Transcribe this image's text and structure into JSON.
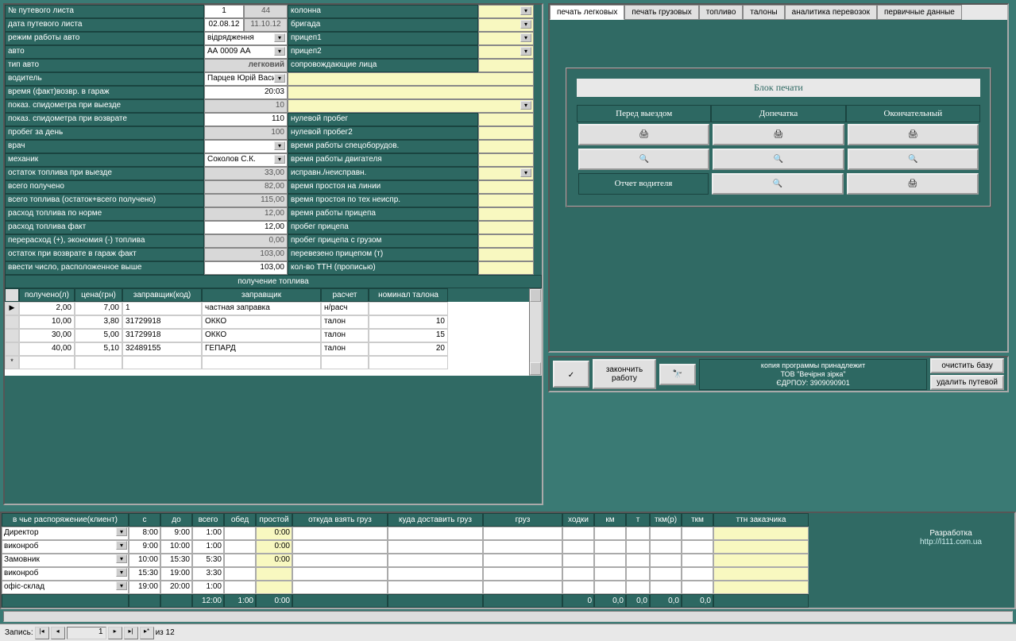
{
  "form_left": {
    "labels": [
      "№ путевого листа",
      "дата путевого листа",
      "режим работы авто",
      "авто",
      "тип авто",
      "водитель",
      "время (факт)возвр. в гараж",
      "показ. спидометра при выезде",
      "показ. спидометра при возврате",
      "пробег за день",
      "врач",
      "механик",
      "остаток топлива при выезде",
      "всего получено",
      "всего топлива (остаток+всего получено)",
      "расход топлива по норме",
      "расход топлива факт",
      "перерасход (+), экономия (-) топлива",
      "остаток при возврате в гараж  факт",
      "ввести число, расположенное выше"
    ],
    "v1a": "1",
    "v1b": "44",
    "v2a": "02.08.12",
    "v2b": "11.10.12",
    "v3": "відрядження",
    "v4": "АА 0009 АА",
    "v5": "легковий",
    "v6": "Парцев Юрій Васи",
    "v7": "20:03",
    "v8": "10",
    "v9": "110",
    "v10": "100",
    "v12": "Соколов С.К.",
    "v13": "33,00",
    "v14": "82,00",
    "v15": "115,00",
    "v16": "12,00",
    "v17": "12,00",
    "v18": "0,00",
    "v19": "103,00",
    "v20": "103,00"
  },
  "form_right": {
    "labels": [
      "колонна",
      "бригада",
      "прицеп1",
      "прицеп2",
      "сопровождающие лица",
      "",
      "",
      "",
      "нулевой пробег",
      "нулевой пробег2",
      "время работы спецоборудов.",
      "время работы двигателя",
      "исправн./неисправн.",
      "время простоя на линии",
      "время простоя по тех неиспр.",
      "время работы прицепа",
      "пробег прицепа",
      "пробег прицепа с грузом",
      "перевезено прицепом (т)",
      "кол-во ТТН (прописью)"
    ]
  },
  "fuel": {
    "title": "получение топлива",
    "headers": [
      "получено(л)",
      "цена(грн)",
      "заправщик(код)",
      "заправщик",
      "расчет",
      "номинал талона"
    ],
    "rows": [
      {
        "l": "2,00",
        "p": "7,00",
        "code": "1",
        "who": "частная заправка",
        "calc": "н/расч",
        "nom": ""
      },
      {
        "l": "10,00",
        "p": "3,80",
        "code": "31729918",
        "who": "ОККО",
        "calc": "талон",
        "nom": "10"
      },
      {
        "l": "30,00",
        "p": "5,00",
        "code": "31729918",
        "who": "ОККО",
        "calc": "талон",
        "nom": "15"
      },
      {
        "l": "40,00",
        "p": "5,10",
        "code": "32489155",
        "who": "ГЕПАРД",
        "calc": "талон",
        "nom": "20"
      }
    ]
  },
  "tabs": [
    "печать легковых",
    "печать грузовых",
    "топливо",
    "талоны",
    "аналитика перевозок",
    "первичные данные"
  ],
  "print": {
    "title": "Блок печати",
    "cols": [
      "Перед выездом",
      "Допечатка",
      "Окончательный"
    ],
    "driver_report": "Отчет водителя"
  },
  "bottom": {
    "finish": "закончить\nработу",
    "copy": "копия программы принадлежит\nТОВ \"Вечірня зірка\"\nЄДРПОУ: 3909090901",
    "clear": "очистить базу",
    "delete": "удалить путевой"
  },
  "sched": {
    "headers": [
      "в чье распоряжение(клиент)",
      "с",
      "до",
      "всего",
      "обед",
      "простой",
      "откуда взять груз",
      "куда доставить груз",
      "груз",
      "ходки",
      "км",
      "т",
      "ткм(р)",
      "ткм",
      "ттн заказчика"
    ],
    "rows": [
      {
        "c": "Директор",
        "s": "8:00",
        "d": "9:00",
        "t": "1:00",
        "o": "",
        "p": "0:00"
      },
      {
        "c": "виконроб",
        "s": "9:00",
        "d": "10:00",
        "t": "1:00",
        "o": "",
        "p": "0:00"
      },
      {
        "c": "Замовник",
        "s": "10:00",
        "d": "15:30",
        "t": "5:30",
        "o": "",
        "p": "0:00"
      },
      {
        "c": "виконроб",
        "s": "15:30",
        "d": "19:00",
        "t": "3:30",
        "o": "",
        "p": ""
      },
      {
        "c": "офіс-склад",
        "s": "19:00",
        "d": "20:00",
        "t": "1:00",
        "o": "",
        "p": ""
      }
    ],
    "sum": {
      "t": "12:00",
      "o": "1:00",
      "p": "0:00",
      "x": "0",
      "km": "0,0",
      "ton": "0,0",
      "tkmr": "0,0",
      "tkm": "0,0"
    }
  },
  "dev": {
    "label": "Разработка",
    "url": "http://l111.com.ua"
  },
  "nav": {
    "label": "Запись:",
    "pos": "1",
    "of": "из 12"
  }
}
